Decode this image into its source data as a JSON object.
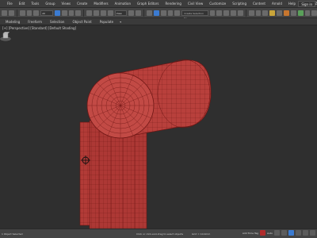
{
  "menubar": {
    "items": [
      "File",
      "Edit",
      "Tools",
      "Group",
      "Views",
      "Create",
      "Modifiers",
      "Animation",
      "Graph Editors",
      "Rendering",
      "Civil View",
      "Customize",
      "Scripting",
      "Content",
      "Arnold",
      "Help",
      "OSSFONZO"
    ],
    "signin_label": "Sign in"
  },
  "toolbar": {
    "filter_value": "All",
    "view_value": "View",
    "selection_set_placeholder": "Create Selection Se"
  },
  "ribbon": {
    "tabs": [
      "Modeling",
      "Freeform",
      "Selection",
      "Object Paint",
      "Populate"
    ]
  },
  "viewport": {
    "label": "[+] [Perspective] [Standard] [Default Shading]",
    "object_color": "#b23b37",
    "wire_color": "#6e1614"
  },
  "statusbar": {
    "selection_text": "1 Object Selected",
    "hint_text": "Click or click-and-drag to select objects",
    "grid_text": "Grid = 10.0mm",
    "add_time_tag": "Add Time Tag",
    "autokey_label": "Auto"
  },
  "colors": {
    "accent_blue": "#3b7bd1",
    "bg": "#2b2b2b"
  }
}
